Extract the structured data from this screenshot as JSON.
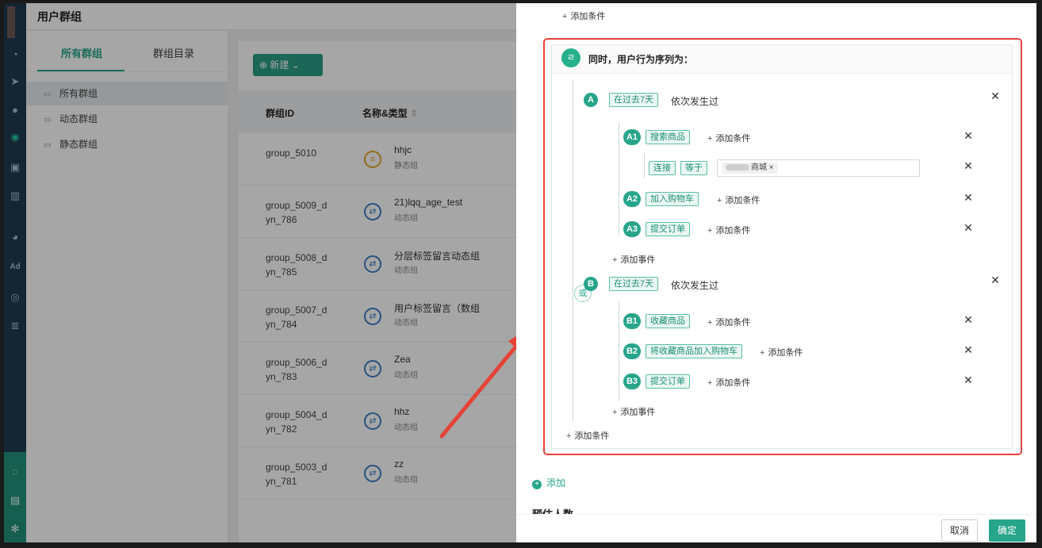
{
  "header": {
    "title": "用户群组"
  },
  "group_tabs": [
    {
      "label": "所有群组"
    },
    {
      "label": "群组目录"
    }
  ],
  "group_sidebar": [
    {
      "label": "所有群组"
    },
    {
      "label": "动态群组"
    },
    {
      "label": "静态群组"
    }
  ],
  "toolbar": {
    "new_label": "新建"
  },
  "table": {
    "headers": {
      "id": "群组ID",
      "name_type": "名称&类型"
    },
    "rows": [
      {
        "id": "group_5010",
        "name": "hhjc",
        "type": "静态组",
        "icon": "static-group-icon"
      },
      {
        "id": "group_5009_d\nyn_786",
        "name": "21)lqq_age_test",
        "type": "动态组",
        "icon": "dynamic-group-icon"
      },
      {
        "id": "group_5008_d\nyn_785",
        "name": "分层标签留言动态组",
        "type": "动态组",
        "icon": "dynamic-group-icon"
      },
      {
        "id": "group_5007_d\nyn_784",
        "name": "用户标签留言（数组",
        "type": "动态组",
        "icon": "dynamic-group-icon"
      },
      {
        "id": "group_5006_d\nyn_783",
        "name": "Zea",
        "type": "动态组",
        "icon": "dynamic-group-icon"
      },
      {
        "id": "group_5004_d\nyn_782",
        "name": "hhz",
        "type": "动态组",
        "icon": "dynamic-group-icon"
      },
      {
        "id": "group_5003_d\nyn_781",
        "name": "zz",
        "type": "动态组",
        "icon": "dynamic-group-icon"
      }
    ]
  },
  "drawer": {
    "top_add_condition": "添加条件",
    "sequence_title": "同时，用户行为序列为：",
    "or_label": "或",
    "seq_a": {
      "badge": "A",
      "period": "在过去7天",
      "relation": "依次发生过"
    },
    "steps_a": [
      {
        "badge": "A1",
        "event": "搜索商品",
        "add": "添加条件"
      },
      {
        "badge": "A2",
        "event": "加入购物车",
        "add": "添加条件"
      },
      {
        "badge": "A3",
        "event": "提交订单",
        "add": "添加条件"
      }
    ],
    "filter_a1": {
      "field": "连接",
      "op": "等于",
      "value": "商城"
    },
    "add_event_a": "添加事件",
    "seq_b": {
      "badge": "B",
      "period": "在过去7天",
      "relation": "依次发生过"
    },
    "steps_b": [
      {
        "badge": "B1",
        "event": "收藏商品",
        "add": "添加条件"
      },
      {
        "badge": "B2",
        "event": "将收藏商品加入购物车",
        "add": "添加条件"
      },
      {
        "badge": "B3",
        "event": "提交订单",
        "add": "添加条件"
      }
    ],
    "add_event_b": "添加事件",
    "bottom_add_condition": "添加条件",
    "add_label": "添加",
    "cut_text": "预估人数",
    "cancel": "取消",
    "confirm": "确定"
  },
  "colors": {
    "accent": "#27a58a",
    "highlight": "#e54339",
    "rail": "#1f3a4f"
  }
}
